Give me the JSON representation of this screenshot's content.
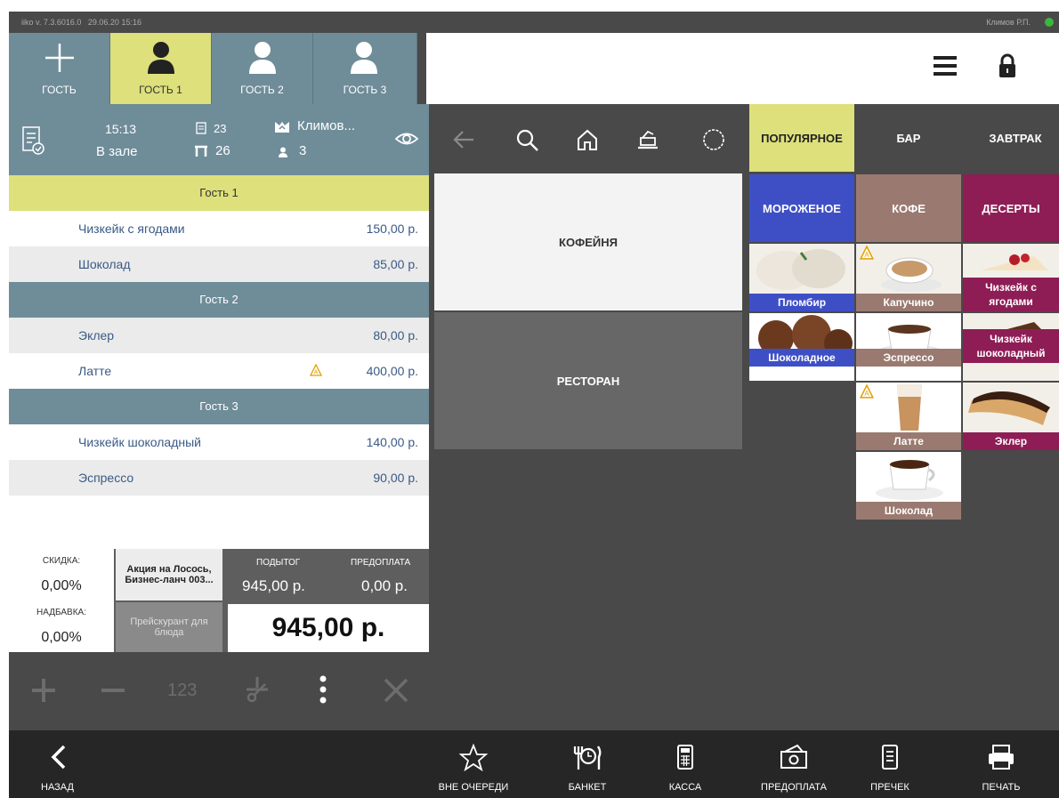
{
  "topbar": {
    "version": "iiko v. 7.3.6016.0",
    "datetime": "29.06.20 15:16",
    "user": "Климов Р.П."
  },
  "guest_tabs": [
    {
      "label": "ГОСТЬ",
      "icon": "plus-icon"
    },
    {
      "label": "ГОСТЬ 1",
      "icon": "person-icon"
    },
    {
      "label": "ГОСТЬ 2",
      "icon": "person-icon"
    },
    {
      "label": "ГОСТЬ 3",
      "icon": "person-icon"
    }
  ],
  "order_info": {
    "time": "15:13",
    "location": "В зале",
    "order_no": "23",
    "table_no": "26",
    "waiter": "Климов...",
    "guests": "3"
  },
  "order": {
    "groups": [
      {
        "name": "Гость 1",
        "items": [
          {
            "name": "Чизкейк с ягодами",
            "price": "150,00 р."
          },
          {
            "name": "Шоколад",
            "price": "85,00 р."
          }
        ]
      },
      {
        "name": "Гость 2",
        "items": [
          {
            "name": "Эклер",
            "price": "80,00 р."
          },
          {
            "name": "Латте",
            "price": "400,00 р.",
            "flag": "A"
          }
        ]
      },
      {
        "name": "Гость 3",
        "items": [
          {
            "name": "Чизкейк шоколадный",
            "price": "140,00 р."
          },
          {
            "name": "Эспрессо",
            "price": "90,00 р."
          }
        ]
      }
    ]
  },
  "totals": {
    "discount_label": "СКИДКА:",
    "discount_value": "0,00%",
    "surcharge_label": "НАДБАВКА:",
    "surcharge_value": "0,00%",
    "promo": "Акция на Лосось, Бизнес-ланч 003...",
    "pricelist": "Прейскурант для блюда",
    "subtotal_label": "ПОДЫТОГ",
    "subtotal_value": "945,00 р.",
    "prepay_label": "ПРЕДОПЛАТА",
    "prepay_value": "0,00 р.",
    "total": "945,00 р."
  },
  "actions": {
    "qty_label": "123"
  },
  "categories": {
    "popular": "ПОПУЛЯРНОЕ",
    "bar": "БАР",
    "breakfast": "ЗАВТРАК",
    "icecream": "МОРОЖЕНОЕ",
    "coffee": "КОФЕ",
    "desserts": "ДЕСЕРТЫ"
  },
  "halls": [
    "КОФЕЙНЯ",
    "РЕСТОРАН"
  ],
  "products": {
    "plombir": "Пломбир",
    "cappuccino": "Капучино",
    "cheesecake_berries": "Чизкейк с ягодами",
    "chocolate_icecream": "Шоколадное",
    "espresso": "Эспрессо",
    "cheesecake_choc": "Чизкейк шоколадный",
    "latte": "Латте",
    "eclair": "Эклер",
    "chocolate": "Шоколад"
  },
  "bottom": {
    "back": "НАЗАД",
    "out_of_queue": "ВНЕ ОЧЕРЕДИ",
    "banquet": "БАНКЕТ",
    "cashier": "КАССА",
    "prepayment": "ПРЕДОПЛАТА",
    "precheck": "ПРЕЧЕК",
    "print": "ПЕЧАТЬ"
  },
  "colors": {
    "slate": "#6f8c99",
    "active": "#dde07b",
    "icecream": "#3e4fc6",
    "coffee": "#9a7a70",
    "desserts": "#8e1d55",
    "dark": "#494949"
  }
}
